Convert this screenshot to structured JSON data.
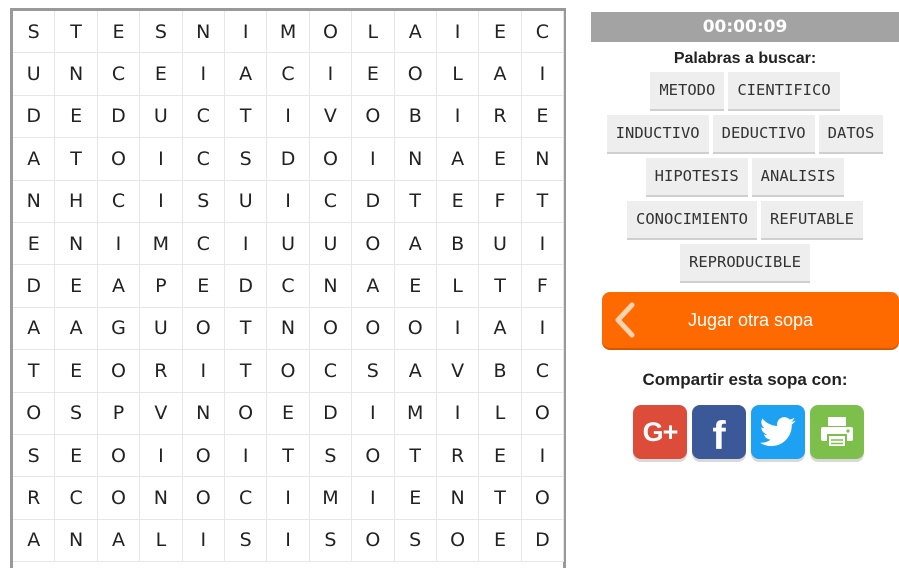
{
  "timer": "00:00:09",
  "words_title": "Palabras a buscar:",
  "word_rows": [
    [
      "METODO",
      "CIENTIFICO"
    ],
    [
      "INDUCTIVO",
      "DEDUCTIVO",
      "DATOS"
    ],
    [
      "HIPOTESIS",
      "ANALISIS"
    ],
    [
      "CONOCIMIENTO",
      "REFUTABLE"
    ],
    [
      "REPRODUCIBLE"
    ]
  ],
  "grid": [
    [
      "S",
      "T",
      "E",
      "S",
      "N",
      "I",
      "M",
      "O",
      "L",
      "A",
      "I",
      "E",
      "C"
    ],
    [
      "U",
      "N",
      "C",
      "E",
      "I",
      "A",
      "C",
      "I",
      "E",
      "O",
      "L",
      "A",
      "I"
    ],
    [
      "D",
      "E",
      "D",
      "U",
      "C",
      "T",
      "I",
      "V",
      "O",
      "B",
      "I",
      "R",
      "E"
    ],
    [
      "A",
      "T",
      "O",
      "I",
      "C",
      "S",
      "D",
      "O",
      "I",
      "N",
      "A",
      "E",
      "N"
    ],
    [
      "N",
      "H",
      "C",
      "I",
      "S",
      "U",
      "I",
      "C",
      "D",
      "T",
      "E",
      "F",
      "T"
    ],
    [
      "E",
      "N",
      "I",
      "M",
      "C",
      "I",
      "U",
      "U",
      "O",
      "A",
      "B",
      "U",
      "I"
    ],
    [
      "D",
      "E",
      "A",
      "P",
      "E",
      "D",
      "C",
      "N",
      "A",
      "E",
      "L",
      "T",
      "F"
    ],
    [
      "A",
      "A",
      "G",
      "U",
      "O",
      "T",
      "N",
      "O",
      "O",
      "O",
      "I",
      "A",
      "I"
    ],
    [
      "T",
      "E",
      "O",
      "R",
      "I",
      "T",
      "O",
      "C",
      "S",
      "A",
      "V",
      "B",
      "C"
    ],
    [
      "O",
      "S",
      "P",
      "V",
      "N",
      "O",
      "E",
      "D",
      "I",
      "M",
      "I",
      "L",
      "O"
    ],
    [
      "S",
      "E",
      "O",
      "I",
      "O",
      "I",
      "T",
      "S",
      "O",
      "T",
      "R",
      "E",
      "I"
    ],
    [
      "R",
      "C",
      "O",
      "N",
      "O",
      "C",
      "I",
      "M",
      "I",
      "E",
      "N",
      "T",
      "O"
    ],
    [
      "A",
      "N",
      "A",
      "L",
      "I",
      "S",
      "I",
      "S",
      "O",
      "S",
      "O",
      "E",
      "D"
    ]
  ],
  "play_button_label": "Jugar otra sopa",
  "share_title": "Compartir esta sopa con:",
  "share": {
    "gplus_label": "G+",
    "facebook_label": "f",
    "icons": [
      "google-plus-icon",
      "facebook-icon",
      "twitter-icon",
      "print-icon"
    ]
  },
  "colors": {
    "accent": "#ff6a00",
    "timer_bg": "#a3a3a3",
    "word_bg": "#eeeeee",
    "gplus": "#dd4b39",
    "facebook": "#3b5998",
    "twitter": "#1da1f2",
    "print": "#7cc04b"
  }
}
